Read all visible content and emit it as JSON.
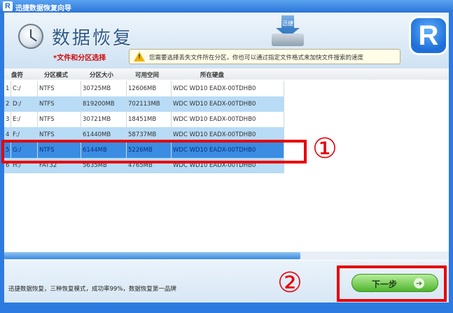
{
  "window": {
    "title": "迅捷数据恢复向导",
    "logo_letter": "R"
  },
  "header": {
    "title": "数据恢复",
    "subtitle": "*文件和分区选择",
    "tip_icon": "warning-icon",
    "tip_icon_glyph": "!",
    "tip_text": "您需要选择丢失文件所在分区，你也可以通过指定文件格式来加快文件搜索的速度",
    "download_icon_label": "迅捷",
    "brand_logo": "R"
  },
  "table": {
    "columns": [
      "盘符",
      "分区模式",
      "分区大小",
      "可用空间",
      "所在硬盘"
    ],
    "rows": [
      {
        "index": "1",
        "drive": "C:/",
        "mode": "NTFS",
        "size": "30725MB",
        "free": "12606MB",
        "disk": "WDC WD10 EADX-00TDHB0"
      },
      {
        "index": "2",
        "drive": "D:/",
        "mode": "NTFS",
        "size": "819200MB",
        "free": "702113MB",
        "disk": "WDC WD10 EADX-00TDHB0"
      },
      {
        "index": "3",
        "drive": "E:/",
        "mode": "NTFS",
        "size": "30721MB",
        "free": "18451MB",
        "disk": "WDC WD10 EADX-00TDHB0"
      },
      {
        "index": "4",
        "drive": "F:/",
        "mode": "NTFS",
        "size": "61440MB",
        "free": "58737MB",
        "disk": "WDC WD10 EADX-00TDHB0"
      },
      {
        "index": "5",
        "drive": "G:/",
        "mode": "NTFS",
        "size": "6144MB",
        "free": "5226MB",
        "disk": "WDC WD10 EADX-00TDHB0"
      },
      {
        "index": "6",
        "drive": "H:/",
        "mode": "FAT32",
        "size": "5635MB",
        "free": "4765MB",
        "disk": "WDC WD10 EADX-00TDHB0"
      }
    ],
    "selected_row_index": 4
  },
  "footer": {
    "text": "迅捷数据恢复，三种恢复模式，成功率99%，数据恢复第一品牌",
    "next_label": "下一步",
    "next_arrow_glyph": "➔"
  },
  "annotations": {
    "marker_1": "①",
    "marker_2": "②"
  },
  "colors": {
    "selected_row": "#3a8de2",
    "alt_row": "#b8dbf6",
    "highlight": "#e8000a",
    "next_button": "#4fb52e"
  }
}
